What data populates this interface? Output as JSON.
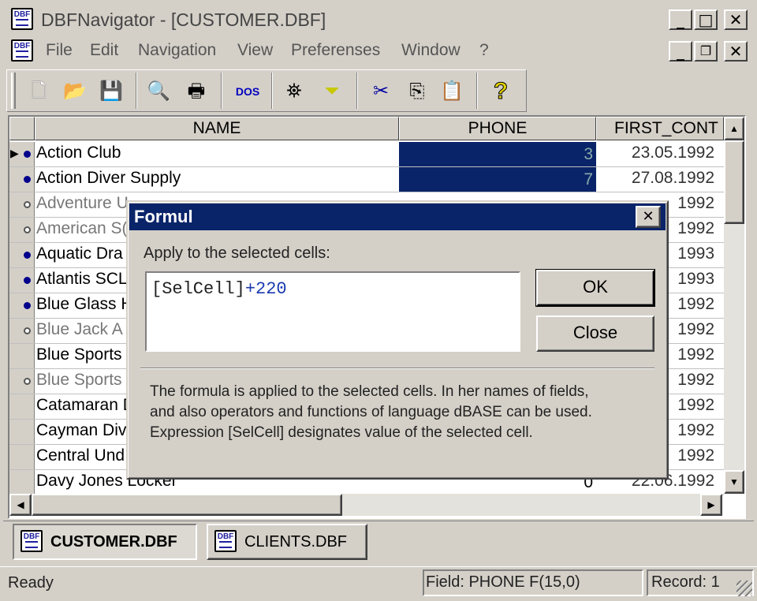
{
  "window": {
    "icon_text": "DBF",
    "title": "DBFNavigator - [CUSTOMER.DBF]",
    "min": "_",
    "max": "□",
    "close": "✕"
  },
  "menu": {
    "icon_text": "DBF",
    "items": [
      "File",
      "Edit",
      "Navigation",
      "View",
      "Preferenses",
      "Window",
      "?"
    ]
  },
  "toolbar": {
    "dos_label": "DOS",
    "icons": [
      "new-file-icon",
      "open-folder-icon",
      "save-disk-icon",
      "print-preview-icon",
      "printer-icon",
      "dos-icon",
      "binoculars-icon",
      "filter-funnel-icon",
      "scissors-icon",
      "copy-icon",
      "paste-icon",
      "help-icon"
    ]
  },
  "grid": {
    "columns": [
      "NAME",
      "PHONE",
      "FIRST_CONT"
    ],
    "rows": [
      {
        "name": "Action Club",
        "phone": "3",
        "date": "23.05.1992",
        "mark": "current"
      },
      {
        "name": "Action Diver Supply",
        "phone": "7",
        "date": "27.08.1992",
        "mark": "filled"
      },
      {
        "name": "Adventure U",
        "phone": "",
        "date": "1992",
        "mark": "hollow"
      },
      {
        "name": "American S(",
        "phone": "",
        "date": "1992",
        "mark": "hollow"
      },
      {
        "name": "Aquatic Dra",
        "phone": "",
        "date": "1993",
        "mark": "filled"
      },
      {
        "name": "Atlantis SCL",
        "phone": "",
        "date": "1993",
        "mark": "filled"
      },
      {
        "name": "Blue Glass H",
        "phone": "",
        "date": "1992",
        "mark": "filled"
      },
      {
        "name": "Blue Jack A",
        "phone": "",
        "date": "1992",
        "mark": "hollow"
      },
      {
        "name": "Blue Sports",
        "phone": "",
        "date": "1992",
        "mark": "none"
      },
      {
        "name": "Blue Sports",
        "phone": "",
        "date": "1992",
        "mark": "hollow"
      },
      {
        "name": "Catamaran D",
        "phone": "",
        "date": "1992",
        "mark": "none"
      },
      {
        "name": "Cayman Div",
        "phone": "",
        "date": "1992",
        "mark": "none"
      },
      {
        "name": "Central Und",
        "phone": "",
        "date": "1992",
        "mark": "none"
      },
      {
        "name": "Davy Jones Locker",
        "phone": "0",
        "date": "22.06.1992",
        "mark": "none"
      }
    ]
  },
  "dialog": {
    "title": "Formul",
    "close": "✕",
    "prompt": "Apply to the selected cells:",
    "formula_cell": "[SelCell]",
    "formula_op": "+220",
    "ok": "OK",
    "close_btn": "Close",
    "help_lines": [
      "The formula is applied to the selected cells. In her names of fields,",
      "and also operators and functions of language dBASE can be used.",
      "Expression [SelCell] designates value of the selected cell."
    ]
  },
  "tabs": [
    {
      "icon_text": "DBF",
      "label": "CUSTOMER.DBF"
    },
    {
      "icon_text": "DBF",
      "label": "CLIENTS.DBF"
    }
  ],
  "status": {
    "ready": "Ready",
    "field": "Field: PHONE F(15,0)",
    "record": "Record: 1"
  }
}
